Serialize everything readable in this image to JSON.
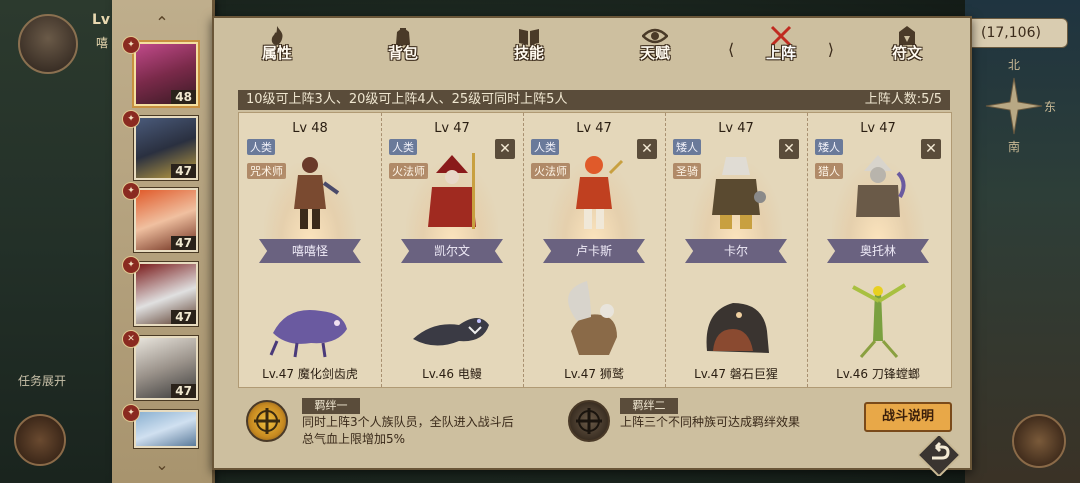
{
  "hud": {
    "level_prefix": "Lv",
    "name_fragment": "嘻",
    "coords": "(17,106)",
    "compass": {
      "north": "北",
      "east": "东",
      "south": "南"
    },
    "task_expand": "任务展开"
  },
  "party": {
    "scroll_up": "⌃",
    "scroll_down": "⌄",
    "slots": [
      {
        "level": "48",
        "badge": "✦",
        "selected": true
      },
      {
        "level": "47",
        "badge": "✦"
      },
      {
        "level": "47",
        "badge": "✦"
      },
      {
        "level": "47",
        "badge": "✦"
      },
      {
        "level": "47",
        "badge": "✕"
      },
      {
        "level": "",
        "badge": "✦"
      }
    ]
  },
  "tabs": [
    {
      "label": "属性",
      "icon": "flame-icon"
    },
    {
      "label": "背包",
      "icon": "bag-icon"
    },
    {
      "label": "技能",
      "icon": "book-icon"
    },
    {
      "label": "天赋",
      "icon": "eye-icon"
    },
    {
      "label": "上阵",
      "icon": "crossed-swords-icon",
      "active": true
    },
    {
      "label": "符文",
      "icon": "rune-icon"
    }
  ],
  "notice": {
    "text": "10级可上阵3人、20级可上阵4人、25级可同时上阵5人",
    "count": "上阵人数:5/5"
  },
  "members": [
    {
      "level": "Lv 48",
      "race": "人类",
      "class": "咒术师",
      "name": "嘻嘻怪",
      "pet": "Lv.47 魔化剑齿虎",
      "removable": false
    },
    {
      "level": "Lv 47",
      "race": "人类",
      "class": "火法师",
      "name": "凯尔文",
      "pet": "Lv.46 电鳗",
      "removable": true
    },
    {
      "level": "Lv 47",
      "race": "人类",
      "class": "火法师",
      "name": "卢卡斯",
      "pet": "Lv.47 狮鹫",
      "removable": true
    },
    {
      "level": "Lv 47",
      "race": "矮人",
      "class": "圣骑",
      "name": "卡尔",
      "pet": "Lv.47 磐石巨猩",
      "removable": true
    },
    {
      "level": "Lv 47",
      "race": "矮人",
      "class": "猎人",
      "name": "奥托林",
      "pet": "Lv.46 刀锋螳螂",
      "removable": true
    }
  ],
  "remove_glyph": "✕",
  "bonds": [
    {
      "title": "羁绊一",
      "desc_line1": "同时上阵3个人族队员，全队进入战斗后",
      "desc_line2": "总气血上限增加5%"
    },
    {
      "title": "羁绊二",
      "desc_line1": "上阵三个不同种族可达成羁绊效果"
    }
  ],
  "battle_button": "战斗说明"
}
